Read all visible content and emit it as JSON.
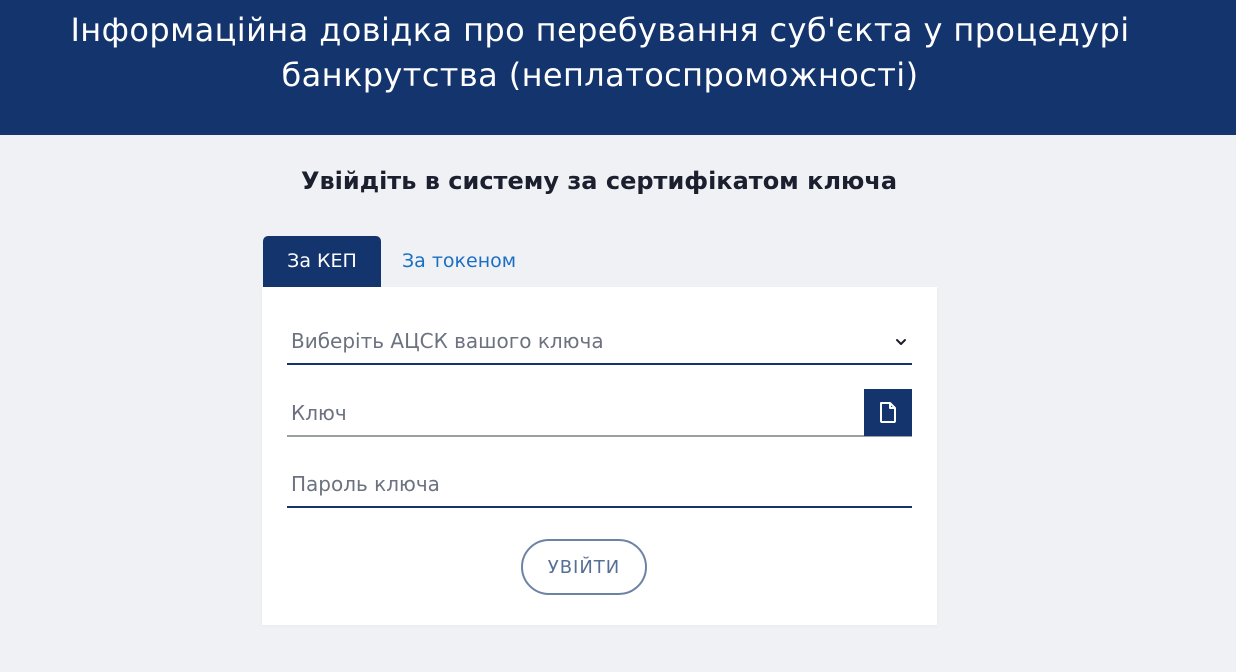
{
  "header": {
    "title_line1": "Інформаційна довідка про перебування суб'єкта у процедурі",
    "title_line2": "банкрутства (неплатоспроможності)"
  },
  "login": {
    "subtitle": "Увійдіть в систему за сертифікатом ключа"
  },
  "tabs": [
    {
      "label": "За КЕП",
      "active": true
    },
    {
      "label": "За токеном",
      "active": false
    }
  ],
  "form": {
    "acsk_placeholder": "Виберіть АЦСК вашого ключа",
    "key_placeholder": "Ключ",
    "password_placeholder": "Пароль ключа",
    "submit_label": "УВІЙТИ",
    "file_icon": "file-icon",
    "chevron_icon": "chevron-down-icon"
  },
  "colors": {
    "brand": "#13346c",
    "tab_link": "#1a6fc3",
    "background": "#f0f1f5",
    "button_border": "#6d83a6"
  }
}
